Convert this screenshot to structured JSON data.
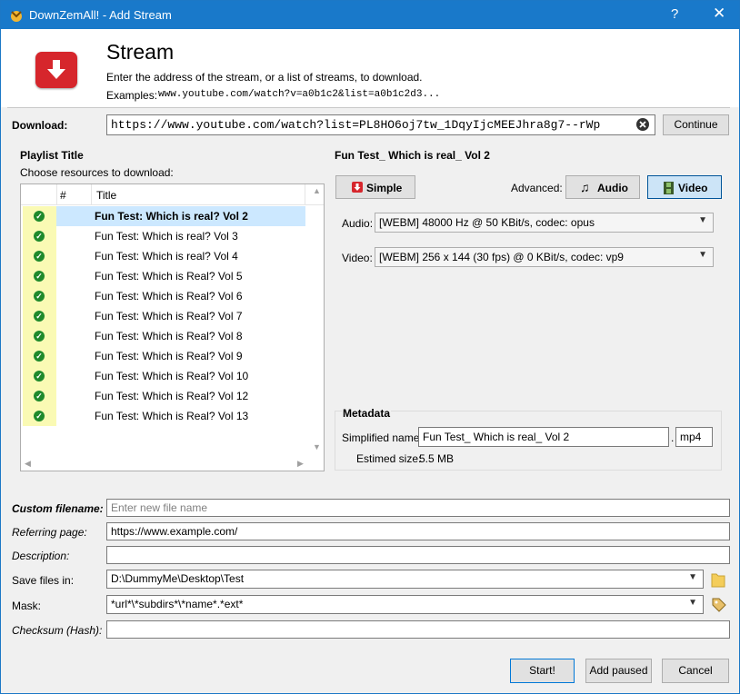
{
  "window": {
    "title": "DownZemAll! - Add Stream",
    "help": "?",
    "close": "✕"
  },
  "header": {
    "title": "Stream",
    "subtitle": "Enter the address of the stream, or a list of streams, to download.",
    "examples_label": "Examples:",
    "examples_value": "www.youtube.com/watch?v=a0b1c2&list=a0b1c2d3..."
  },
  "download": {
    "label": "Download:",
    "url": "https://www.youtube.com/watch?list=PL8HO6oj7tw_1DqyIjcMEEJhra8g7--rWp",
    "continue_label": "Continue"
  },
  "playlist": {
    "title": "Playlist Title",
    "choose": "Choose resources to download:",
    "columns": [
      "#",
      "Title"
    ],
    "items": [
      {
        "title": "Fun Test: Which is real? Vol 2",
        "checked": true,
        "selected": true
      },
      {
        "title": "Fun Test: Which is real? Vol 3",
        "checked": true
      },
      {
        "title": "Fun Test: Which is real? Vol 4",
        "checked": true
      },
      {
        "title": "Fun Test: Which is Real? Vol 5",
        "checked": true
      },
      {
        "title": "Fun Test: Which is Real? Vol 6",
        "checked": true
      },
      {
        "title": "Fun Test: Which is Real? Vol 7",
        "checked": true
      },
      {
        "title": "Fun Test: Which is Real? Vol 8",
        "checked": true
      },
      {
        "title": "Fun Test: Which is Real? Vol 9",
        "checked": true
      },
      {
        "title": "Fun Test: Which is Real? Vol 10",
        "checked": true
      },
      {
        "title": "Fun Test: Which is Real? Vol 12",
        "checked": true
      },
      {
        "title": "Fun Test: Which is Real? Vol 13",
        "checked": true
      }
    ]
  },
  "stream": {
    "title": "Fun Test_ Which is real_ Vol 2",
    "simple_label": "Simple",
    "advanced_label": "Advanced:",
    "audio_btn": "Audio",
    "video_btn": "Video",
    "audio_label": "Audio:",
    "audio_value": "[WEBM] 48000 Hz @ 50 KBit/s, codec: opus",
    "video_label": "Video:",
    "video_value": "[WEBM] 256 x 144 (30 fps) @ 0 KBit/s, codec: vp9"
  },
  "metadata": {
    "title": "Metadata",
    "name_label": "Simplified name:",
    "name_value": "Fun Test_ Which is real_ Vol 2",
    "dot": ".",
    "ext": "mp4",
    "size_label": "Estimed size:",
    "size_value": "5.5 MB"
  },
  "form": {
    "custom_label": "Custom filename:",
    "custom_placeholder": "Enter new file name",
    "referring_label": "Referring page:",
    "referring_value": "https://www.example.com/",
    "description_label": "Description:",
    "description_value": "",
    "save_label": "Save files in:",
    "save_value": "D:\\DummyMe\\Desktop\\Test",
    "mask_label": "Mask:",
    "mask_value": "*url*\\*subdirs*\\*name*.*ext*",
    "checksum_label": "Checksum (Hash):",
    "checksum_value": ""
  },
  "buttons": {
    "start": "Start!",
    "add_paused": "Add paused",
    "cancel": "Cancel"
  },
  "colors": {
    "titlebar": "#1979ca",
    "accent": "#d6262c",
    "selection": "#cce8ff",
    "check_bg": "#fafab4"
  }
}
